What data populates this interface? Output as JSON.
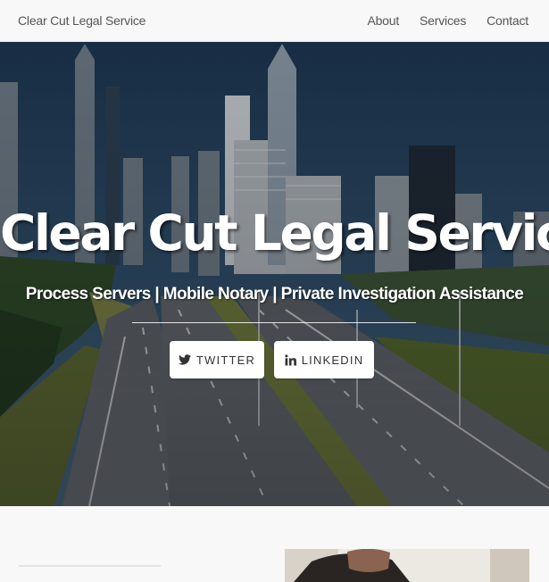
{
  "navbar": {
    "brand": "Clear Cut Legal Service",
    "links": [
      {
        "label": "About"
      },
      {
        "label": "Services"
      },
      {
        "label": "Contact"
      }
    ]
  },
  "hero": {
    "title": "Clear Cut Legal Service",
    "subtitle": "Process Servers | Mobile Notary | Private Investigation Assistance",
    "buttons": [
      {
        "label": "TWITTER",
        "icon": "twitter-icon"
      },
      {
        "label": "LINKEDIN",
        "icon": "linkedin-icon"
      }
    ]
  },
  "colors": {
    "navbar_bg": "#f8f8f8",
    "nav_text": "#555555",
    "hero_text": "#ffffff",
    "button_bg": "#ffffff"
  }
}
